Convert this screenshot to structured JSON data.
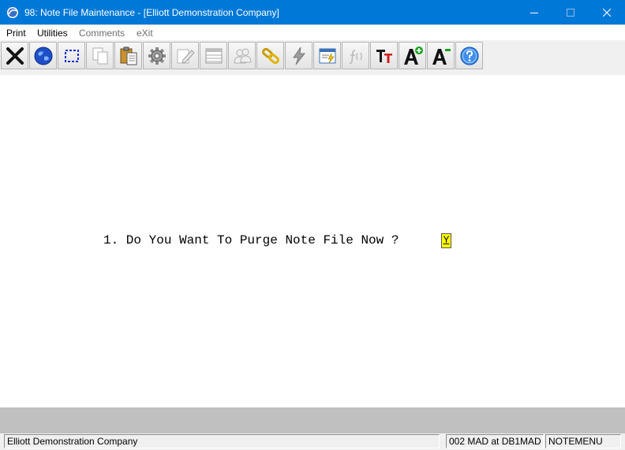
{
  "window": {
    "title": "98: Note File Maintenance - [Elliott Demonstration Company]",
    "controls": [
      "minimize",
      "maximize",
      "close"
    ]
  },
  "menu": [
    {
      "label": "Print",
      "enabled": true
    },
    {
      "label": "Utilities",
      "enabled": true
    },
    {
      "label": "Comments",
      "enabled": false
    },
    {
      "label": "eXit",
      "enabled": false
    }
  ],
  "toolbar": [
    {
      "icon": "close-x-icon",
      "enabled": true
    },
    {
      "icon": "globe-icon",
      "enabled": true
    },
    {
      "icon": "select-region-icon",
      "enabled": true
    },
    {
      "icon": "copy-icon",
      "enabled": false
    },
    {
      "icon": "paste-icon",
      "enabled": true
    },
    {
      "icon": "gear-icon",
      "enabled": true
    },
    {
      "icon": "edit-note-icon",
      "enabled": false
    },
    {
      "icon": "spreadsheet-icon",
      "enabled": false
    },
    {
      "icon": "users-icon",
      "enabled": false
    },
    {
      "icon": "chain-link-icon",
      "enabled": true
    },
    {
      "icon": "lightning-icon",
      "enabled": false
    },
    {
      "icon": "window-flash-icon",
      "enabled": true
    },
    {
      "icon": "function-icon",
      "enabled": false
    },
    {
      "icon": "font-size-icon",
      "enabled": true
    },
    {
      "icon": "font-increase-icon",
      "enabled": true
    },
    {
      "icon": "font-decrease-icon",
      "enabled": true
    },
    {
      "icon": "help-icon",
      "enabled": true
    }
  ],
  "form": {
    "question": "1. Do You Want To Purge Note File Now ?",
    "answer": "Y"
  },
  "status": {
    "company": "Elliott Demonstration Company",
    "session": "002 MAD at DB1MAD",
    "menu": "NOTEMENU"
  },
  "colors": {
    "titlebar": "#0078d7",
    "answer_highlight": "#ffff00",
    "grey_band": "#c0c0c0"
  }
}
